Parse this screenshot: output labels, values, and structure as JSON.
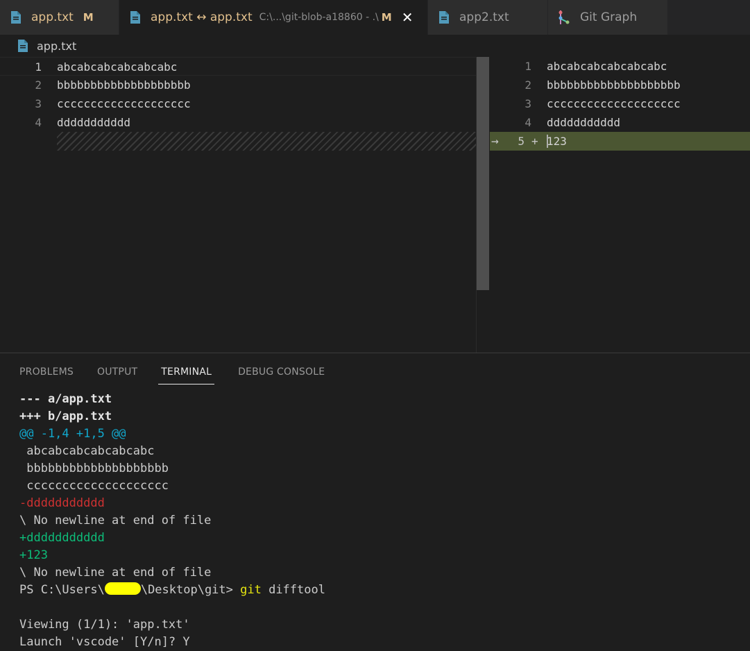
{
  "tabs": [
    {
      "title": "app.txt",
      "badge": "M"
    },
    {
      "title": "app.txt ↔ app.txt",
      "description": "C:\\...\\git-blob-a18860 - .\\",
      "badge": "M",
      "close": "✕"
    },
    {
      "title": "app2.txt"
    },
    {
      "title": "Git Graph"
    }
  ],
  "breadcrumb": {
    "file": "app.txt"
  },
  "left_editor": {
    "lines": [
      {
        "num": "1",
        "text": "abcabcabcabcabcabc"
      },
      {
        "num": "2",
        "text": "bbbbbbbbbbbbbbbbbbbb"
      },
      {
        "num": "3",
        "text": "cccccccccccccccccccc"
      },
      {
        "num": "4",
        "text": "ddddddddddd"
      }
    ]
  },
  "right_editor": {
    "lines": [
      {
        "num": "1",
        "text": "abcabcabcabcabcabc"
      },
      {
        "num": "2",
        "text": "bbbbbbbbbbbbbbbbbbbb"
      },
      {
        "num": "3",
        "text": "cccccccccccccccccccc"
      },
      {
        "num": "4",
        "text": "ddddddddddd"
      },
      {
        "num": "5",
        "text": "123",
        "marker": "+",
        "arrow": "→"
      }
    ]
  },
  "panel": {
    "tabs": [
      "PROBLEMS",
      "OUTPUT",
      "TERMINAL",
      "DEBUG CONSOLE"
    ],
    "active_tab": "TERMINAL"
  },
  "terminal": {
    "lines": [
      "--- a/app.txt",
      "+++ b/app.txt",
      "@@ -1,4 +1,5 @@",
      " abcabcabcabcabcabc",
      " bbbbbbbbbbbbbbbbbbbb",
      " cccccccccccccccccccc",
      "-ddddddddddd",
      "\\ No newline at end of file",
      "+ddddddddddd",
      "+123",
      "\\ No newline at end of file"
    ],
    "prompt_prefix": "PS C:\\Users\\",
    "prompt_suffix": "\\Desktop\\git> ",
    "command_keyword": "git",
    "command_args": " difftool",
    "output": [
      "Viewing (1/1): 'app.txt'",
      "Launch 'vscode' [Y/n]? Y"
    ]
  },
  "colors": {
    "modified": "#e2c08d",
    "inserted_line": "#4b5632",
    "diff_add": "#0dbc79",
    "diff_del": "#cd3131",
    "diff_hunk": "#11a8cd",
    "file_icon": "#519aba"
  },
  "icons": {
    "file": "file-icon",
    "graph": "git-graph-icon",
    "arrow": "arrow-right-icon"
  }
}
